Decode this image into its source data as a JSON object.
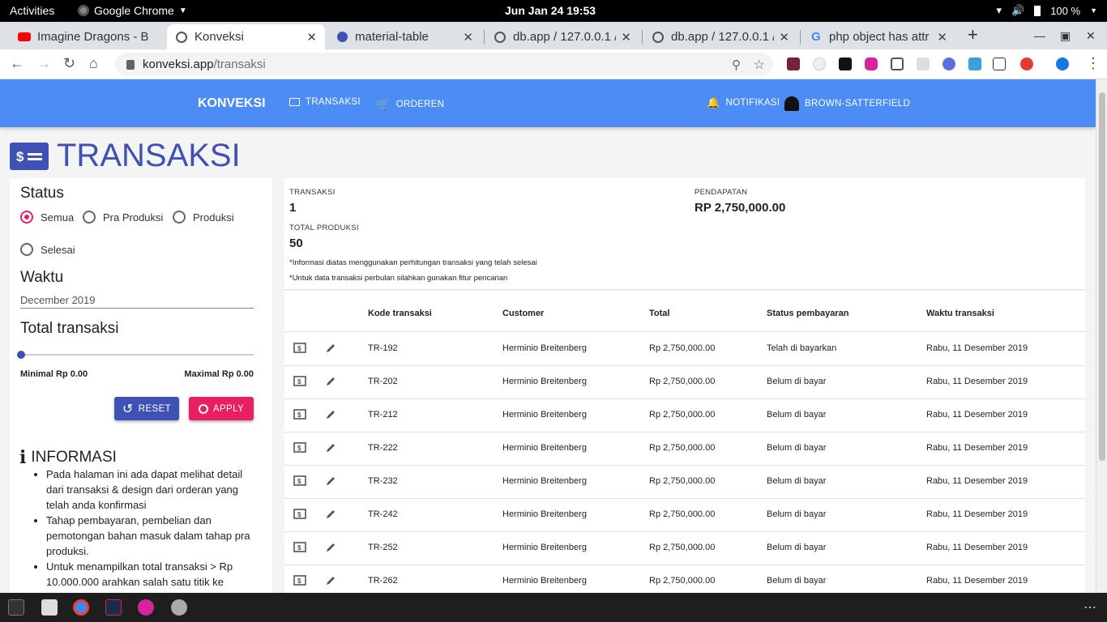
{
  "topbar": {
    "activities": "Activities",
    "app_name": "Google Chrome",
    "clock": "Jun Jan 24  19:53",
    "battery": "100 %"
  },
  "tabs": [
    {
      "title": "Imagine Dragons - B",
      "icon": "youtube-icon"
    },
    {
      "title": "Konveksi",
      "icon": "globe-icon"
    },
    {
      "title": "material-table",
      "icon": "material-table-icon"
    },
    {
      "title": "db.app / 127.0.0.1 /",
      "icon": "globe-icon"
    },
    {
      "title": "db.app / 127.0.0.1 /",
      "icon": "globe-icon"
    },
    {
      "title": "php object has attr",
      "icon": "google-icon"
    }
  ],
  "omnibox": {
    "host": "konveksi.app",
    "path": "/transaksi"
  },
  "appbar": {
    "brand": "KONVEKSI",
    "nav_transaksi": "TRANSAKSI",
    "nav_orderen": "ORDEREN",
    "notifikasi": "NOTIFIKASI",
    "user": "BROWN-SATTERFIELD"
  },
  "page_title": "TRANSAKSI",
  "filter": {
    "status_title": "Status",
    "options": [
      "Semua",
      "Pra Produksi",
      "Produksi",
      "Selesai"
    ],
    "selected": "Semua",
    "waktu_title": "Waktu",
    "waktu_value": "December 2019",
    "total_title": "Total transaksi",
    "minimal": "Minimal Rp 0.00",
    "maximal": "Maximal Rp 0.00",
    "slider_fraction": 0,
    "reset_label": "RESET",
    "apply_label": "APPLY"
  },
  "informasi": {
    "title": "INFORMASI",
    "items": [
      "Pada halaman ini ada dapat melihat detail dari transaksi & design dari orderan yang telah anda konfirmasi",
      "Tahap pembayaran, pembelian dan pemotongan bahan masuk dalam tahap pra produksi.",
      "Untuk menampilkan total transaksi > Rp 10.000.000 arahkan salah satu titik ke"
    ]
  },
  "summary": {
    "transaksi_label": "TRANSAKSI",
    "transaksi_value": "1",
    "pendapatan_label": "PENDAPATAN",
    "pendapatan_value": "RP 2,750,000.00",
    "produksi_label": "TOTAL PRODUKSI",
    "produksi_value": "50",
    "note1": "*Informasi diatas menggunakan perhitungan transaksi yang telah selesai",
    "note2": "*Untuk data transaksi perbulan silahkan gunakan fitur pencarian"
  },
  "table": {
    "columns": [
      "Kode transaksi",
      "Customer",
      "Total",
      "Status pembayaran",
      "Waktu transaksi"
    ],
    "rows": [
      [
        "TR-192",
        "Herminio Breitenberg",
        "Rp 2,750,000.00",
        "Telah di bayarkan",
        "Rabu, 11 Desember 2019"
      ],
      [
        "TR-202",
        "Herminio Breitenberg",
        "Rp 2,750,000.00",
        "Belum di bayar",
        "Rabu, 11 Desember 2019"
      ],
      [
        "TR-212",
        "Herminio Breitenberg",
        "Rp 2,750,000.00",
        "Belum di bayar",
        "Rabu, 11 Desember 2019"
      ],
      [
        "TR-222",
        "Herminio Breitenberg",
        "Rp 2,750,000.00",
        "Belum di bayar",
        "Rabu, 11 Desember 2019"
      ],
      [
        "TR-232",
        "Herminio Breitenberg",
        "Rp 2,750,000.00",
        "Belum di bayar",
        "Rabu, 11 Desember 2019"
      ],
      [
        "TR-242",
        "Herminio Breitenberg",
        "Rp 2,750,000.00",
        "Belum di bayar",
        "Rabu, 11 Desember 2019"
      ],
      [
        "TR-252",
        "Herminio Breitenberg",
        "Rp 2,750,000.00",
        "Belum di bayar",
        "Rabu, 11 Desember 2019"
      ],
      [
        "TR-262",
        "Herminio Breitenberg",
        "Rp 2,750,000.00",
        "Belum di bayar",
        "Rabu, 11 Desember 2019"
      ]
    ]
  },
  "colors": {
    "appbar": "#4c8cf5",
    "primary": "#3f51b5",
    "accent": "#e91e63"
  }
}
